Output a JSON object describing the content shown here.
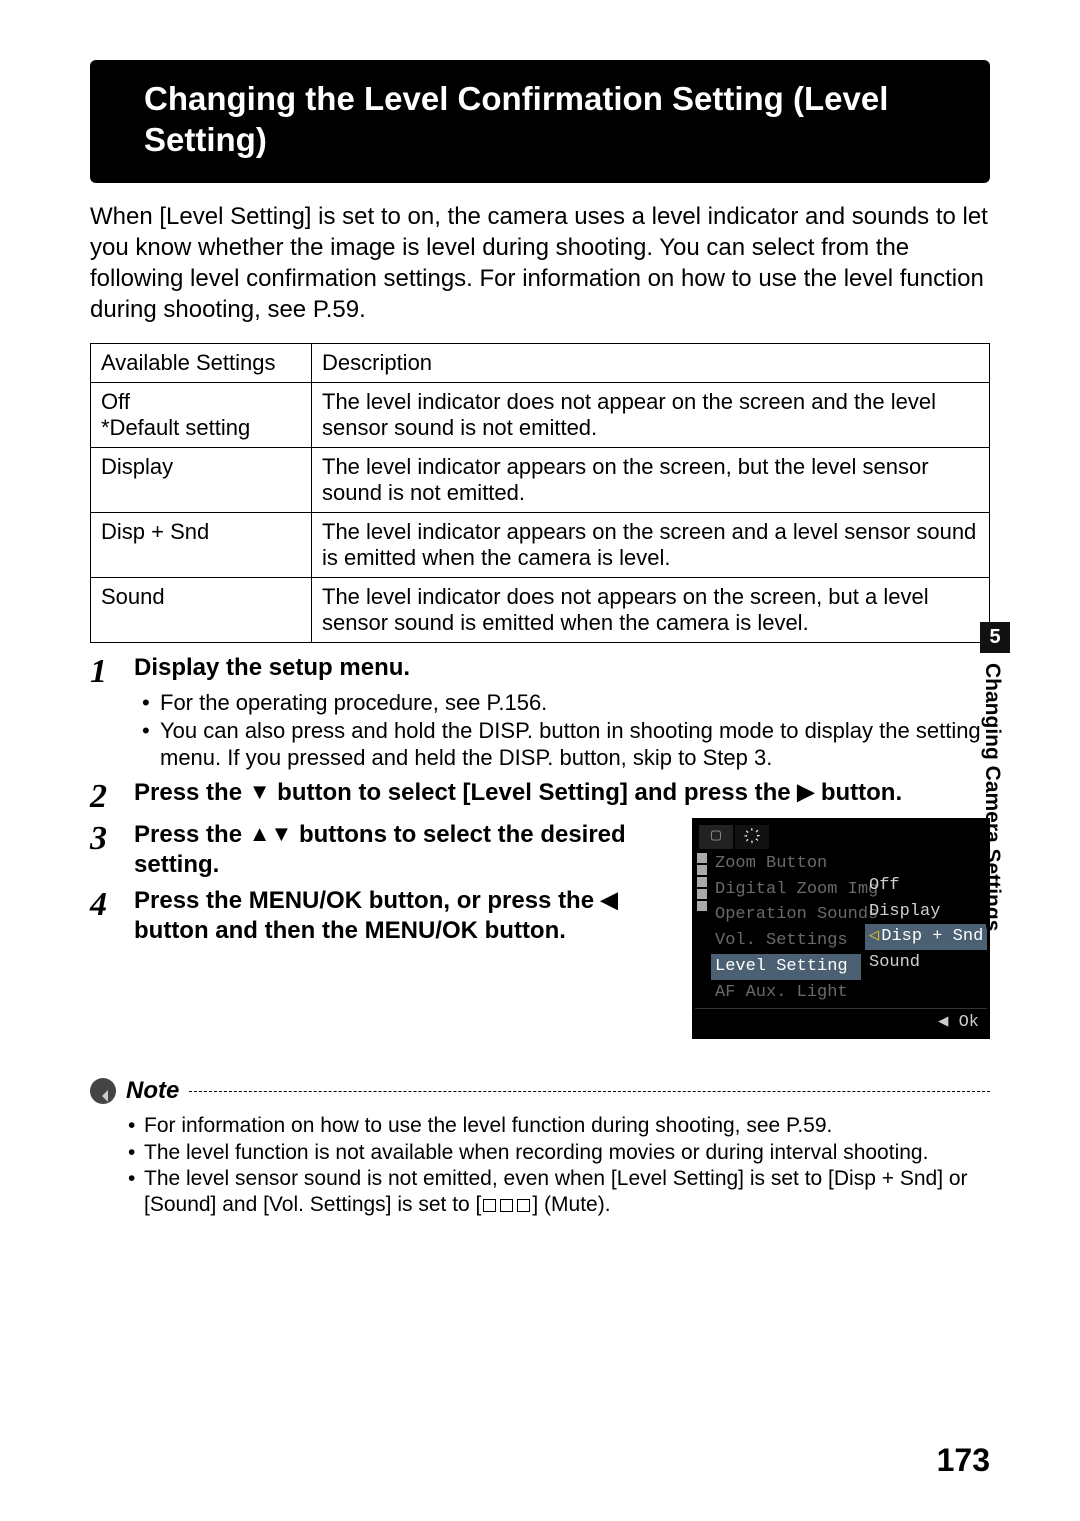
{
  "title": "Changing the Level Confirmation Setting (Level Setting)",
  "intro": "When [Level Setting] is set to on, the camera uses a level indicator and sounds to let you know whether the image is level during shooting. You can select from the following level confirmation settings. For information on how to use the level function during shooting, see P.59.",
  "table": {
    "headers": [
      "Available Settings",
      "Description"
    ],
    "rows": [
      {
        "setting": "Off",
        "note": "*Default setting",
        "desc": "The level indicator does not appear on the screen and the level sensor sound is not emitted."
      },
      {
        "setting": "Display",
        "note": "",
        "desc": "The level indicator appears on the screen, but the level sensor sound is not emitted."
      },
      {
        "setting": "Disp + Snd",
        "note": "",
        "desc": "The level indicator appears on the screen and a level sensor sound is emitted when the camera is level."
      },
      {
        "setting": "Sound",
        "note": "",
        "desc": "The level indicator does not appears on the screen, but a level sensor sound is emitted when the camera is level."
      }
    ]
  },
  "steps": {
    "s1": {
      "title": "Display the setup menu.",
      "bullets": [
        "For the operating procedure, see P.156.",
        "You can also press and hold the DISP. button in shooting mode to display the setting menu. If you pressed and held the DISP. button, skip to Step 3."
      ]
    },
    "s2": {
      "title_pre": "Press the ",
      "title_mid": " button to select [Level Setting] and press the ",
      "title_post": " button."
    },
    "s3": {
      "title_pre": "Press the ",
      "title_post": " buttons to select the desired setting."
    },
    "s4": {
      "title_pre": "Press the MENU/OK button, or press the ",
      "title_post": " button and then the MENU/OK button."
    }
  },
  "screen": {
    "menu": [
      "Zoom Button",
      "Digital Zoom Img",
      "Operation Sounds",
      "Vol. Settings",
      "Level Setting",
      "AF Aux. Light"
    ],
    "menu_selected": "Level Setting",
    "values": [
      "Off",
      "Display",
      "Disp + Snd",
      "Sound"
    ],
    "value_selected": "Disp + Snd",
    "footer": "◀ Ok"
  },
  "side": {
    "num": "5",
    "label": "Changing Camera Settings"
  },
  "note": {
    "label": "Note",
    "items": [
      "For information on how to use the level function during shooting, see P.59.",
      "The level function is not available when recording movies or during interval shooting.",
      "The level sensor sound is not emitted, even when [Level Setting] is set to [Disp + Snd] or [Sound] and [Vol. Settings] is set to [MUTE] (Mute)."
    ]
  },
  "page_number": "173"
}
